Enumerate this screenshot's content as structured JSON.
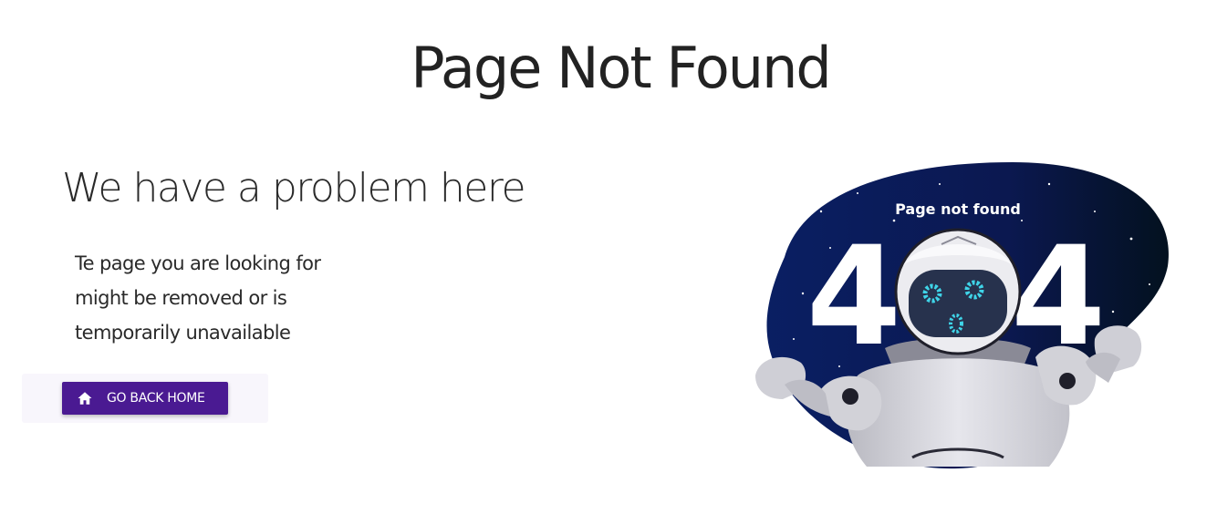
{
  "header": {
    "title": "Page Not Found"
  },
  "main": {
    "subtitle": "We have a problem here",
    "description_lines": [
      "Te page you are looking for",
      "might be removed or is",
      "temporarily unavailable"
    ],
    "home_button": {
      "label": "GO BACK HOME",
      "icon": "home-icon"
    }
  },
  "illustration": {
    "caption": "Page not found",
    "digit_left": "4",
    "digit_right": "4"
  },
  "colors": {
    "accent": "#4a1a92",
    "blob_dark": "#0b1a4f",
    "robot_eye": "#3fd4e8"
  }
}
